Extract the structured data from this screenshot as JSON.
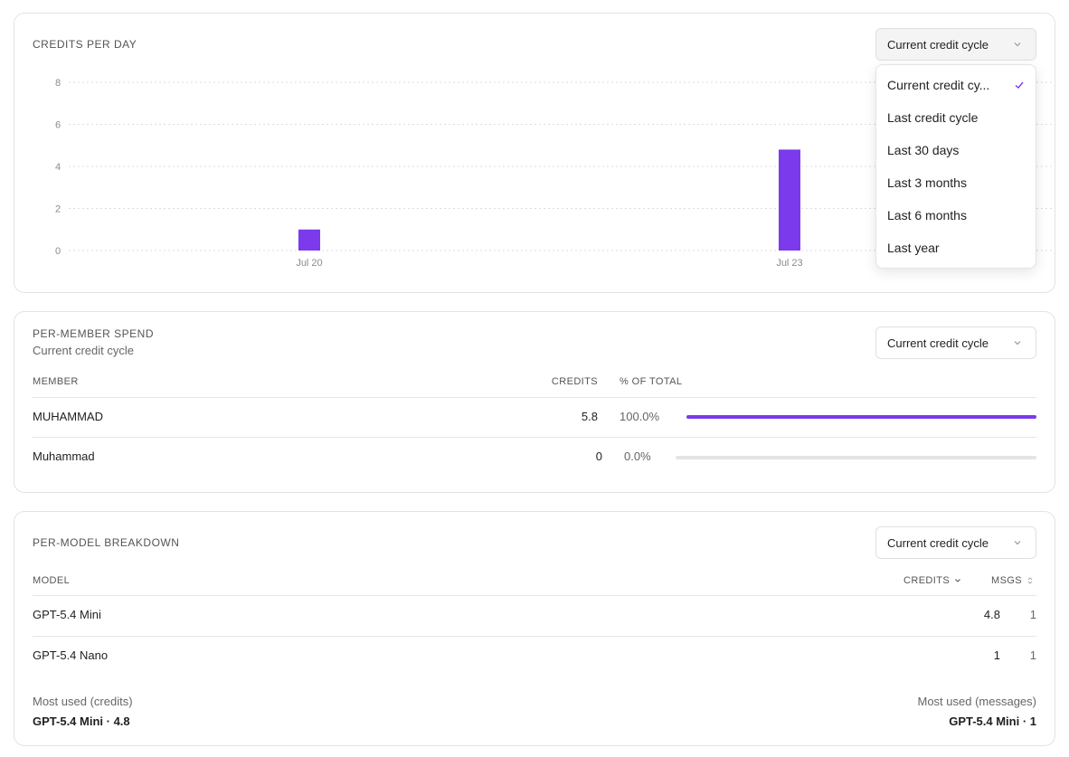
{
  "credits_per_day": {
    "title": "CREDITS PER DAY",
    "range_select": {
      "label": "Current credit cycle",
      "icon": "chevron-down-icon"
    },
    "range_menu": {
      "items": [
        {
          "label": "Current credit cy...",
          "selected": true
        },
        {
          "label": "Last credit cycle",
          "selected": false
        },
        {
          "label": "Last 30 days",
          "selected": false
        },
        {
          "label": "Last 3 months",
          "selected": false
        },
        {
          "label": "Last 6 months",
          "selected": false
        },
        {
          "label": "Last year",
          "selected": false
        }
      ]
    }
  },
  "chart_data": {
    "type": "bar",
    "title": "CREDITS PER DAY",
    "xlabel": "",
    "ylabel": "",
    "ylim": [
      0,
      8
    ],
    "yticks": [
      0,
      2,
      4,
      6,
      8
    ],
    "x_tick_labels": [
      "Jul 20",
      "Jul 23"
    ],
    "series": [
      {
        "values": [
          {
            "x": "Jul 20",
            "y": 1
          },
          {
            "x": "Jul 23",
            "y": 4.8
          }
        ]
      }
    ],
    "grid": true,
    "color": "#7c3aed"
  },
  "per_member": {
    "title": "PER-MEMBER SPEND",
    "subtitle": "Current credit cycle",
    "range_select": {
      "label": "Current credit cycle"
    },
    "columns": {
      "member": "MEMBER",
      "credits": "CREDITS",
      "pct": "% OF TOTAL"
    },
    "rows": [
      {
        "member": "MUHAMMAD",
        "credits": "5.8",
        "pct": "100.0%",
        "fraction": 1.0
      },
      {
        "member": "Muhammad",
        "credits": "0",
        "pct": "0.0%",
        "fraction": 0.0
      }
    ]
  },
  "per_model": {
    "title": "PER-MODEL BREAKDOWN",
    "range_select": {
      "label": "Current credit cycle"
    },
    "columns": {
      "model": "MODEL",
      "credits": "CREDITS",
      "msgs": "MSGS"
    },
    "rows": [
      {
        "model": "GPT-5.4 Mini",
        "credits": "4.8",
        "msgs": "1"
      },
      {
        "model": "GPT-5.4 Nano",
        "credits": "1",
        "msgs": "1"
      }
    ],
    "footer": {
      "most_used_credits_label": "Most used (credits)",
      "most_used_credits_value": "GPT-5.4 Mini · 4.8",
      "most_used_messages_label": "Most used (messages)",
      "most_used_messages_value": "GPT-5.4 Mini · 1"
    }
  },
  "colors": {
    "accent": "#7c3aed",
    "track": "#e4e4e7",
    "border": "#e3e3e3"
  }
}
